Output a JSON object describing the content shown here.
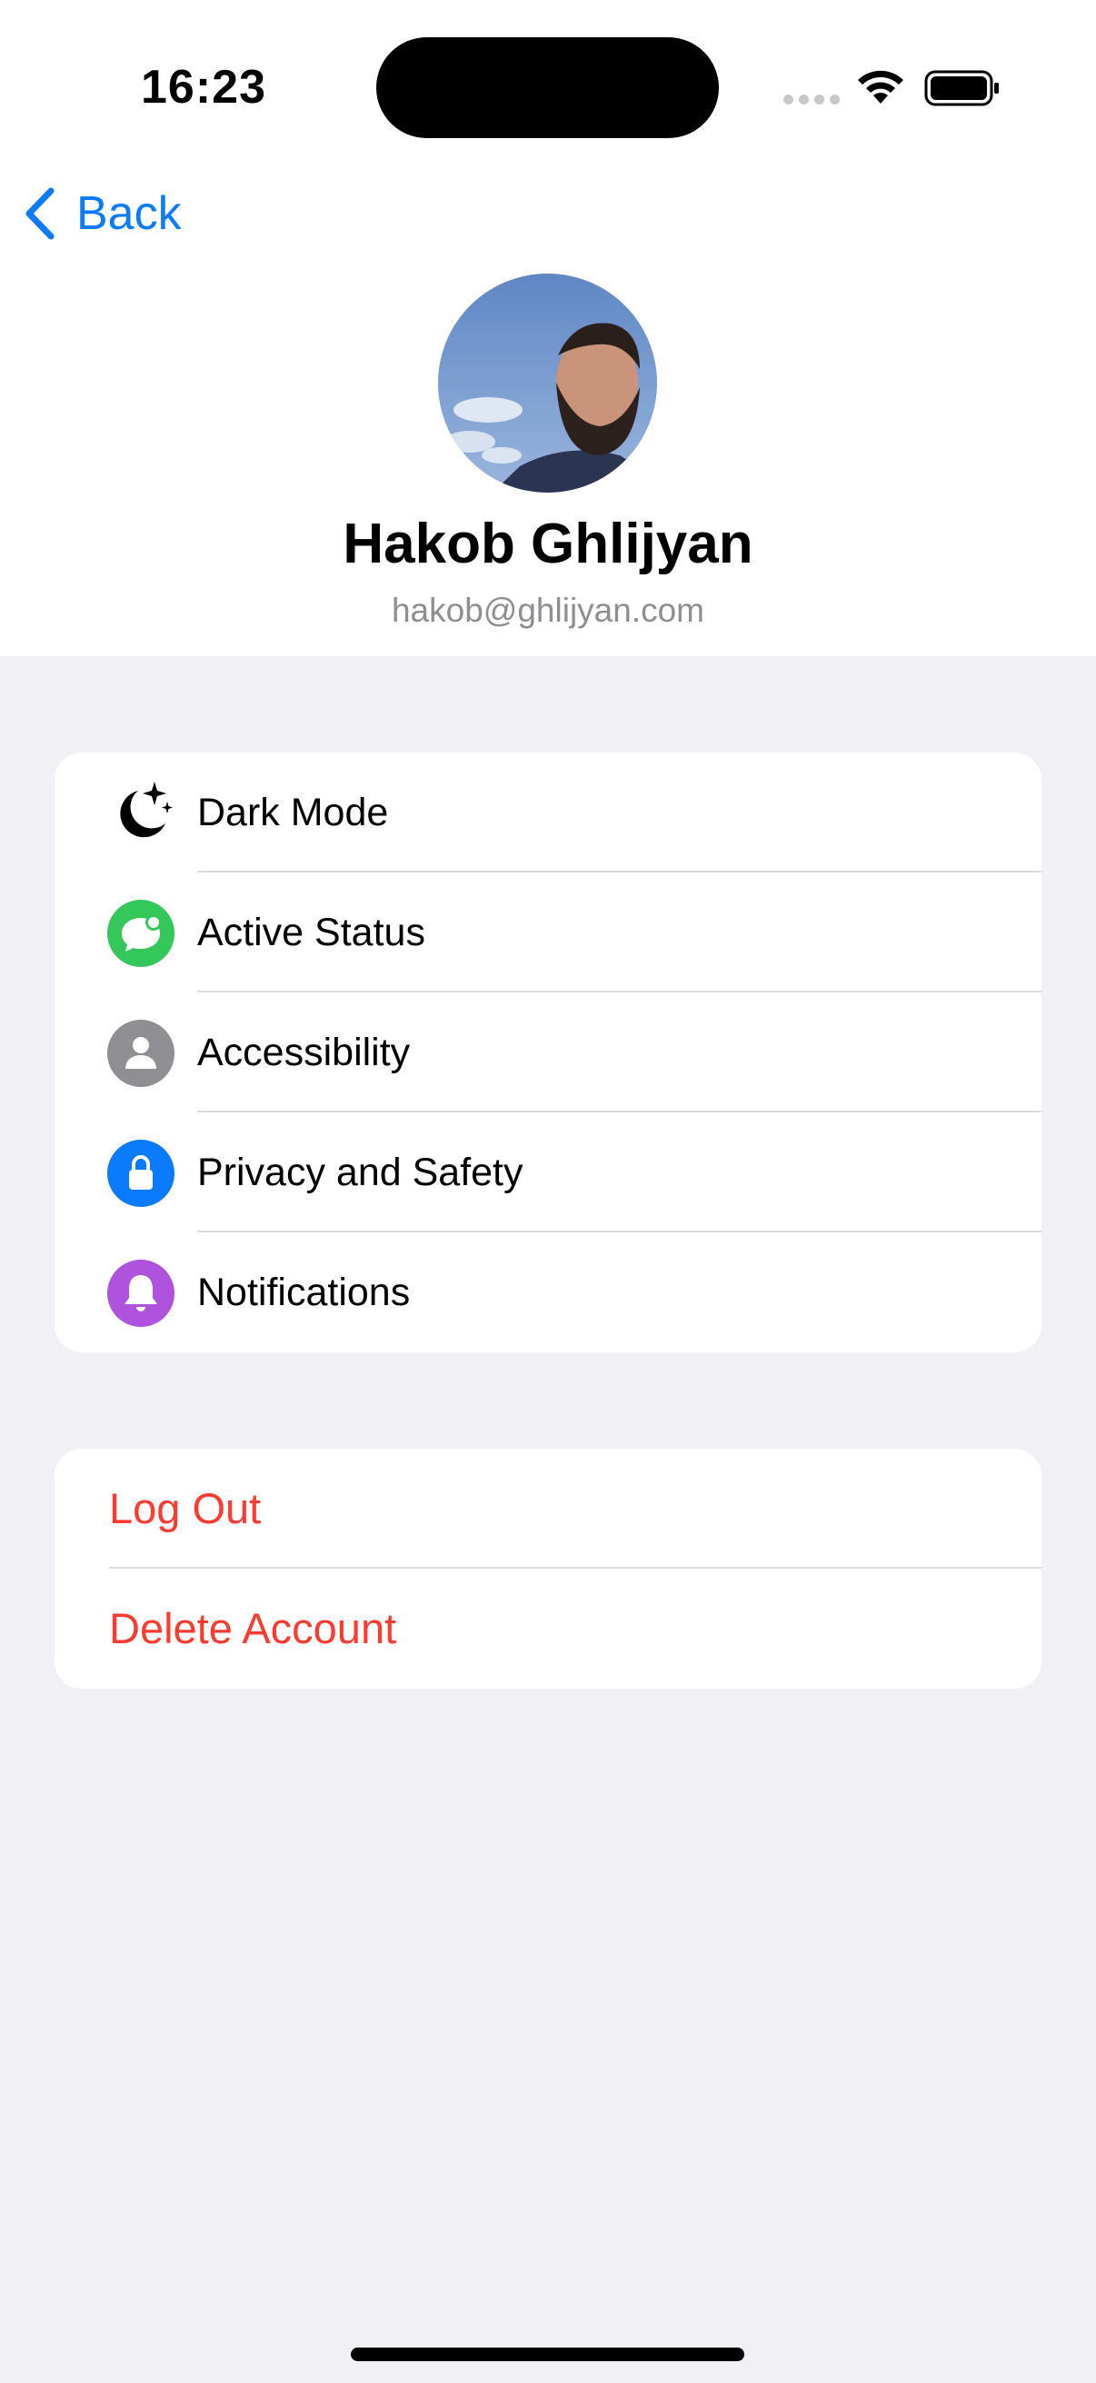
{
  "status_bar": {
    "time": "16:23"
  },
  "nav": {
    "back_label": "Back"
  },
  "profile": {
    "name": "Hakob Ghlijyan",
    "email": "hakob@ghlijyan.com"
  },
  "settings": [
    {
      "label": "Dark Mode",
      "icon": "moon-stars-icon",
      "color": "#000000"
    },
    {
      "label": "Active Status",
      "icon": "message-badge-icon",
      "color": "#34c759"
    },
    {
      "label": "Accessibility",
      "icon": "person-icon",
      "color": "#8e8e93"
    },
    {
      "label": "Privacy and Safety",
      "icon": "lock-icon",
      "color": "#0a7aff"
    },
    {
      "label": "Notifications",
      "icon": "bell-icon",
      "color": "#af52de"
    }
  ],
  "account": [
    {
      "label": "Log Out"
    },
    {
      "label": "Delete Account"
    }
  ],
  "colors": {
    "accent": "#0a7aff",
    "destructive": "#ff3b30",
    "background": "#f0f0f5"
  }
}
